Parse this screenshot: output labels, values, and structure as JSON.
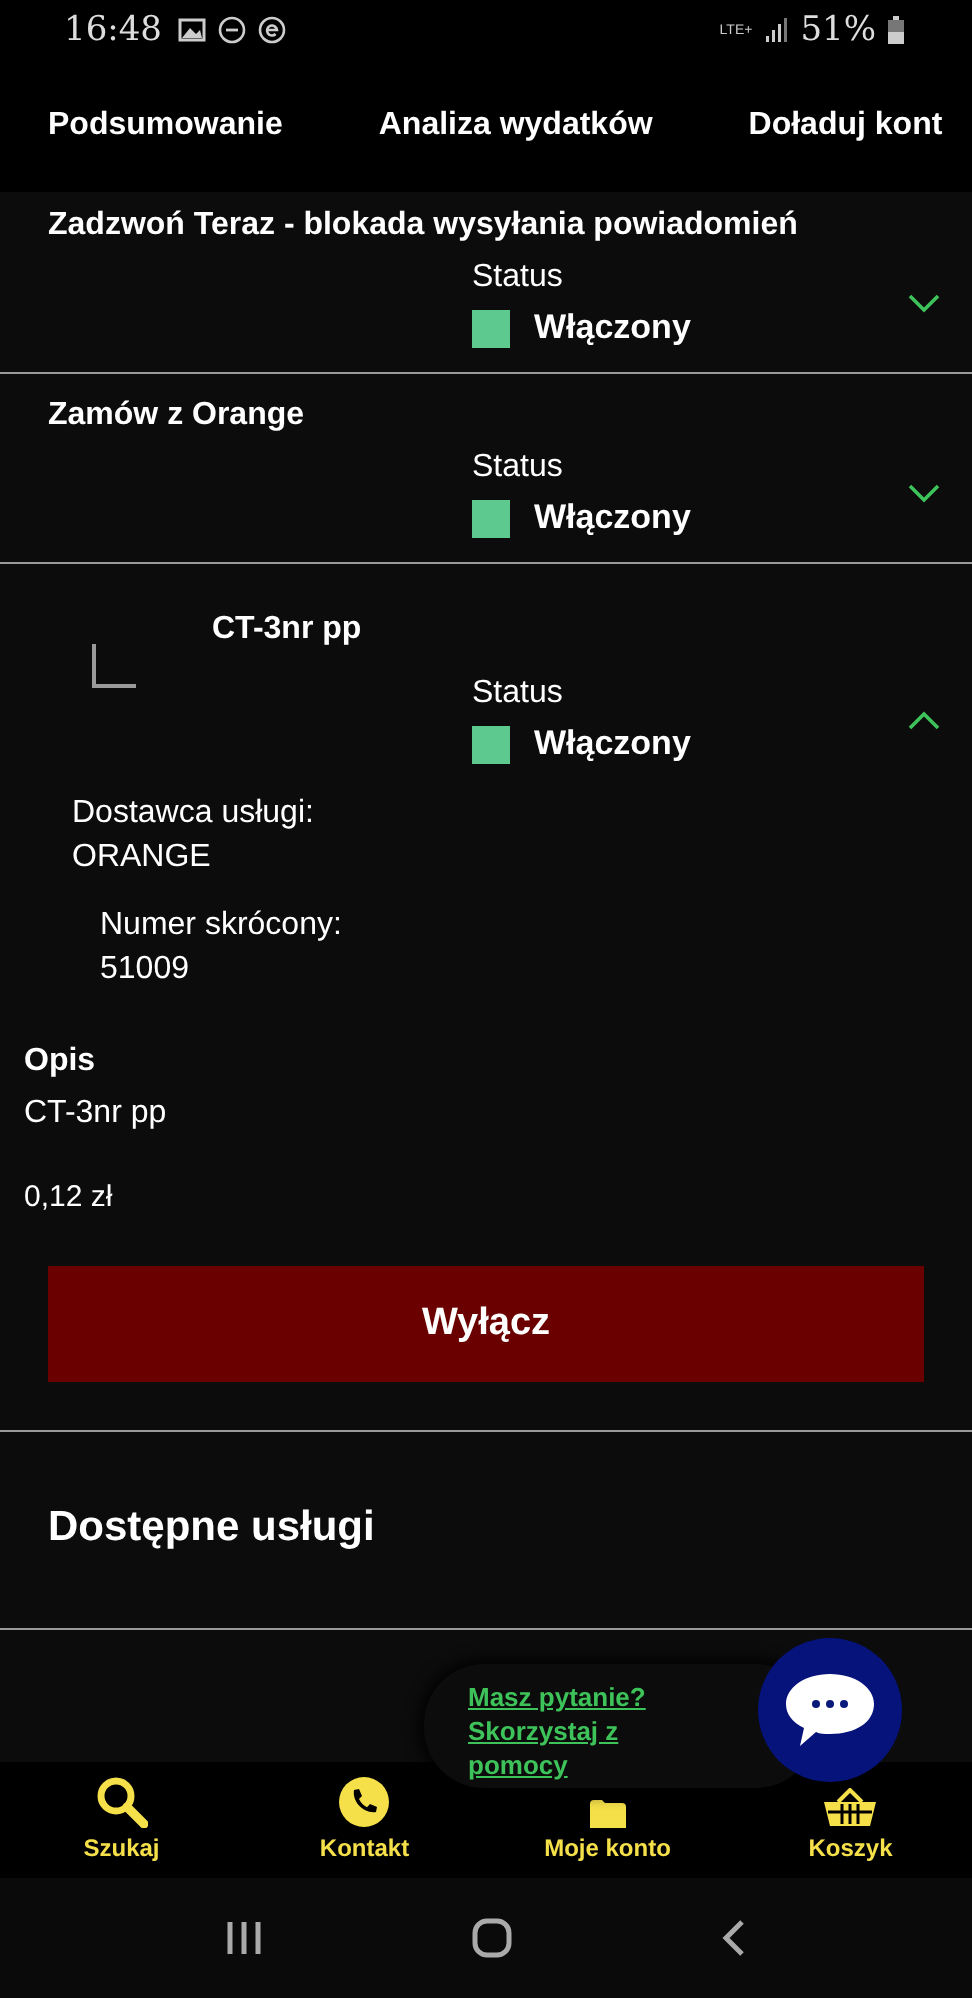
{
  "status_bar": {
    "time": "16:48",
    "network": "LTE+",
    "battery": "51%"
  },
  "tabs": [
    {
      "label": "Podsumowanie"
    },
    {
      "label": "Analiza wydatków"
    },
    {
      "label": "Doładuj kont"
    }
  ],
  "services": [
    {
      "title": "Zadzwoń Teraz - blokada wysyłania powiadomień",
      "status_label": "Status",
      "status": "Włączony",
      "expanded": false
    },
    {
      "title": "Zamów z Orange",
      "status_label": "Status",
      "status": "Włączony",
      "expanded": false
    },
    {
      "title": "CT-3nr pp",
      "status_label": "Status",
      "status": "Włączony",
      "expanded": true,
      "provider_label": "Dostawca usługi:",
      "provider": "ORANGE",
      "number_label": "Numer skrócony:",
      "number": "51009"
    }
  ],
  "description": {
    "heading": "Opis",
    "text": "CT-3nr pp",
    "price": "0,12 zł"
  },
  "disable_button": "Wyłącz",
  "available_heading": "Dostępne usługi",
  "help": {
    "line1": "Masz pytanie?",
    "line2": "Skorzystaj z pomocy"
  },
  "bottom_nav": [
    {
      "label": "Szukaj",
      "kind": "search"
    },
    {
      "label": "Kontakt",
      "kind": "phone"
    },
    {
      "label": "Moje konto",
      "kind": "account"
    },
    {
      "label": "Koszyk",
      "kind": "basket"
    }
  ]
}
